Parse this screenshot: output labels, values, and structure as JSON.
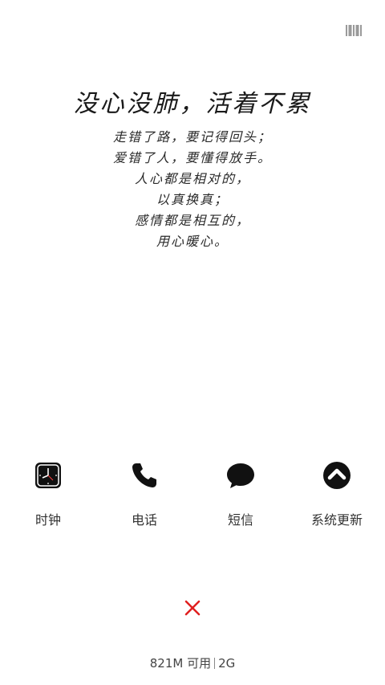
{
  "wallpaper": {
    "title": "没心没肺，活着不累",
    "lines": [
      "走错了路，要记得回头；",
      "爱错了人，要懂得放手。",
      "人心都是相对的，",
      "以真换真；",
      "感情都是相互的，",
      "用心暖心。"
    ]
  },
  "top_bar": {
    "icon": "barcode-icon"
  },
  "apps": [
    {
      "label": "时钟",
      "icon": "clock-icon"
    },
    {
      "label": "电话",
      "icon": "phone-icon"
    },
    {
      "label": "短信",
      "icon": "message-icon"
    },
    {
      "label": "系统更新",
      "icon": "update-icon"
    }
  ],
  "close": {
    "icon": "close-icon",
    "color": "#e02020"
  },
  "memory": {
    "available": "821M 可用",
    "total": "2G"
  }
}
